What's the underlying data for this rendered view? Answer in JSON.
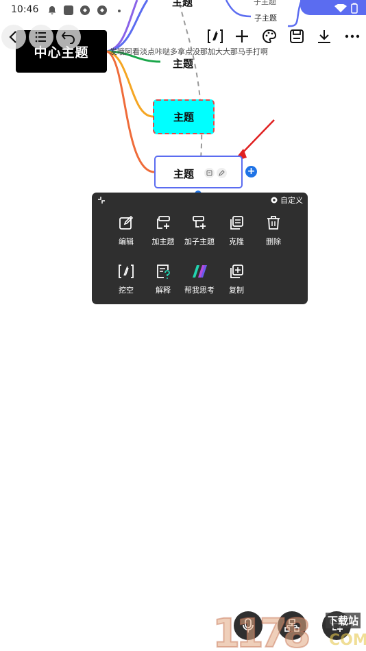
{
  "status_bar": {
    "time": "10:46"
  },
  "mindmap": {
    "center_topic": "中心主题",
    "note": "发哦阿看淡点咔哒多拿点没那加大大那马手打啊",
    "topic_top": "主题",
    "sub_topic_top": "子主题",
    "sub_topic_partial": "子主题",
    "topic_green": "主题",
    "topic_cyan": "主题",
    "topic_selected": "主题"
  },
  "toolbar": {
    "back_icon": "back-icon",
    "outline_icon": "outline-icon",
    "undo_icon": "undo-icon",
    "cloze_icon": "cloze-icon",
    "add_icon": "add-icon",
    "palette_icon": "palette-icon",
    "save_icon": "save-icon",
    "download_icon": "download-icon",
    "more_icon": "more-icon"
  },
  "context_menu": {
    "customize_label": "自定义",
    "items": [
      {
        "label": "编辑",
        "icon": "edit-icon"
      },
      {
        "label": "加主题",
        "icon": "add-topic-icon"
      },
      {
        "label": "加子主题",
        "icon": "add-subtopic-icon"
      },
      {
        "label": "克隆",
        "icon": "clone-icon"
      },
      {
        "label": "删除",
        "icon": "delete-icon"
      },
      {
        "label": "挖空",
        "icon": "cloze-icon"
      },
      {
        "label": "解释",
        "icon": "explain-icon"
      },
      {
        "label": "帮我思考",
        "icon": "ai-think-icon"
      },
      {
        "label": "复制",
        "icon": "copy-icon"
      }
    ]
  },
  "watermark": {
    "brand_number": "1178",
    "brand_tag": "下载站",
    "brand_domain": "COM"
  },
  "colors": {
    "accent": "#5b6cf0",
    "cyan_node": "#00ffff",
    "menu_bg": "#2f2f2f",
    "add_blue": "#1f73e6",
    "arrow_red": "#e02020"
  }
}
